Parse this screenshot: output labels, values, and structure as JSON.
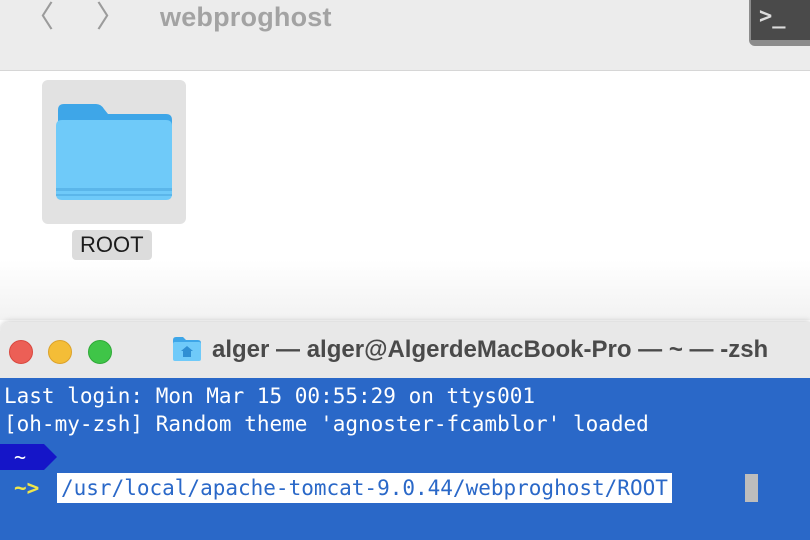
{
  "finder": {
    "back_glyph": "〈",
    "forward_glyph": "〉",
    "title": "webproghost",
    "terminal_button_glyph": ">_",
    "items": [
      {
        "label": "ROOT",
        "icon": "folder-icon",
        "color": "#5ebdf5"
      }
    ]
  },
  "terminal": {
    "title": "alger — alger@AlgerdeMacBook-Pro — ~ — -zsh",
    "lines": [
      "Last login: Mon Mar 15 00:55:29 on ttys001",
      "[oh-my-zsh] Random theme 'agnoster-fcamblor' loaded"
    ],
    "prompt_segment": "~",
    "prompt_arrow": "~>",
    "input_value": "/usr/local/apache-tomcat-9.0.44/webproghost/ROOT",
    "colors": {
      "background": "#2a68c8",
      "segment": "#1515c8",
      "arrow": "#f0e64a"
    }
  }
}
